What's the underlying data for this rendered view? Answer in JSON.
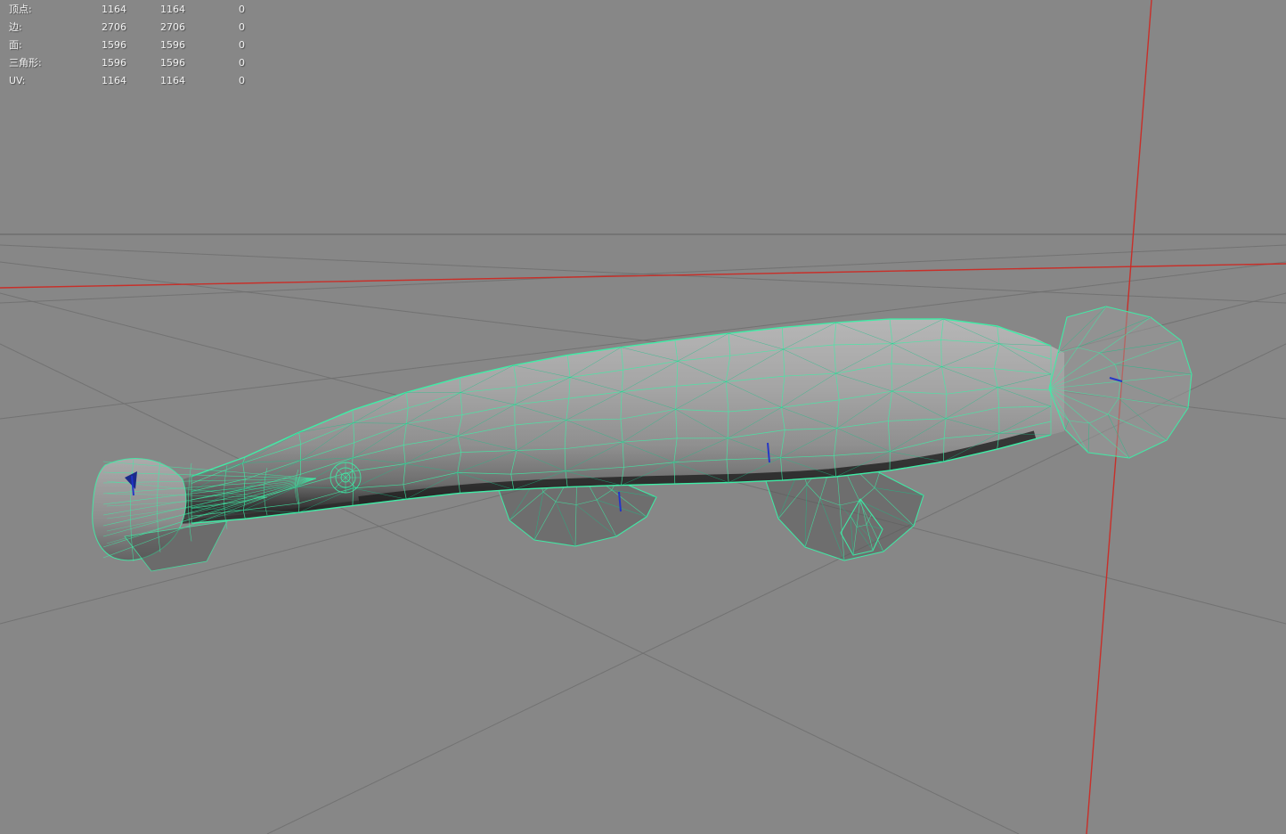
{
  "viewport": {
    "background": "#878787",
    "grid": "#6e6e6e",
    "horizon": "#5d5d5d",
    "axis": "#cb2a24",
    "wire": "#3feca6",
    "wire_dark": "#17c187",
    "tick": "#2133c9",
    "text": "#f2f2f2"
  },
  "stats": {
    "rows": [
      {
        "label": "顶点:",
        "a": "1164",
        "b": "1164",
        "c": "0"
      },
      {
        "label": "边:",
        "a": "2706",
        "b": "2706",
        "c": "0"
      },
      {
        "label": "面:",
        "a": "1596",
        "b": "1596",
        "c": "0"
      },
      {
        "label": "三角形:",
        "a": "1596",
        "b": "1596",
        "c": "0"
      },
      {
        "label": "UV:",
        "a": "1164",
        "b": "1164",
        "c": "0"
      }
    ]
  }
}
